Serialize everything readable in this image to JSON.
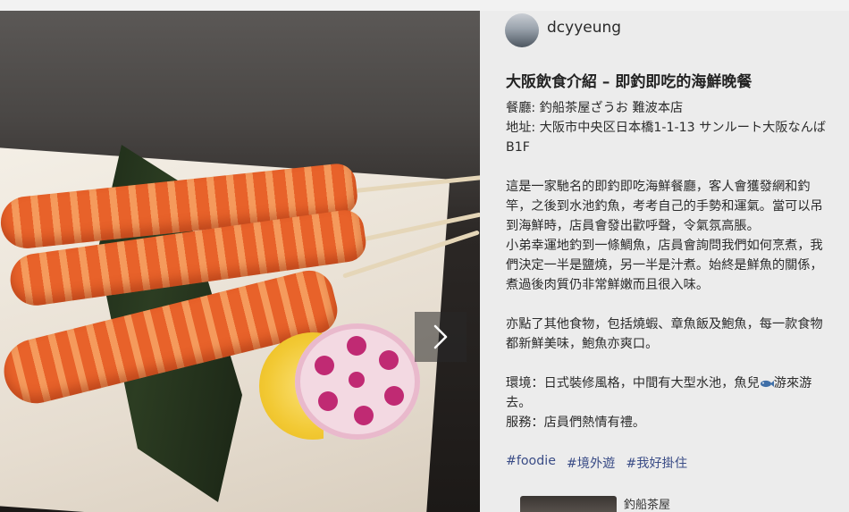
{
  "post": {
    "username": "dcyyeung",
    "title": "大阪飲食介紹 – 即釣即吃的海鮮晚餐",
    "restaurant": "餐廳: 釣船茶屋ざうお 難波本店",
    "address": "地址: 大阪市中央区日本橋1-1-13 サンルート大阪なんば",
    "address_floor": "B1F",
    "para1_lines": [
      "這是一家馳名的即釣即吃海鮮餐廳，客人會獲發網和釣",
      "竿，之後到水池釣魚，考考自己的手勢和運氣。當可以吊",
      "到海鮮時，店員會發出歡呼聲，令氣氛高脹。",
      "小弟幸運地釣到一條鯛魚，店員會詢問我們如何烹煮，我",
      "們決定一半是鹽燒，另一半是汁煮。始終是鮮魚的關係，",
      "煮過後肉質仍非常鮮嫩而且很入味。"
    ],
    "para2_lines": [
      "亦點了其他食物，包括燒蝦、章魚飯及鮑魚，每一款食物",
      "都新鮮美味，鮑魚亦爽口。"
    ],
    "env_before": "環境：日式裝修風格，中間有大型水池，魚兒",
    "env_after": "游來游",
    "env_line2": "去。",
    "service": "服務：店員們熱情有禮。",
    "hashtags": [
      "#foodie",
      "#境外遊",
      "#我好掛住"
    ],
    "related_label": "釣船茶屋"
  },
  "icons": {
    "next": "chevron-right-icon",
    "fish": "fish-emoji-icon"
  },
  "colors": {
    "panel_bg": "#ececec",
    "hashtag": "#3a4c86"
  }
}
